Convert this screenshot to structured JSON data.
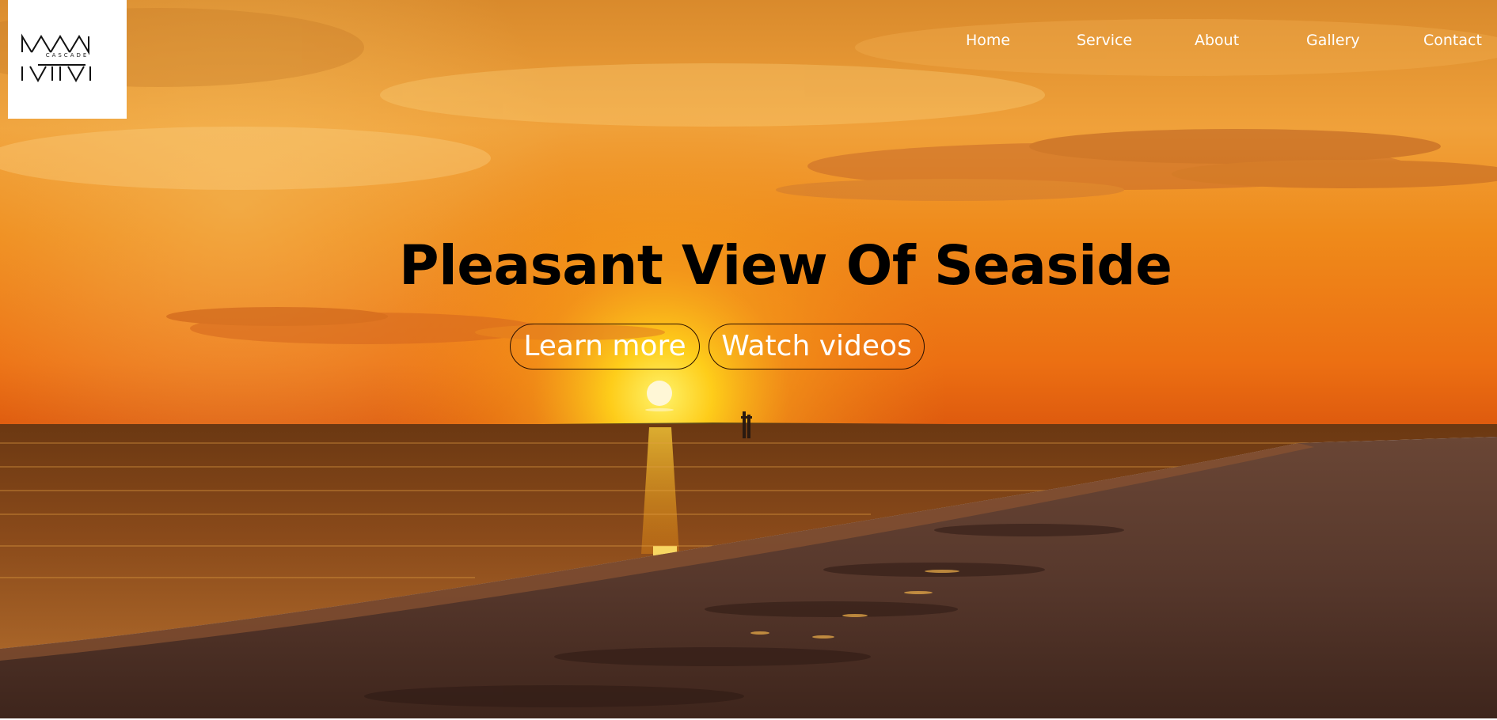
{
  "brand": {
    "logo_text": "CASCADE"
  },
  "nav": {
    "items": [
      {
        "label": "Home"
      },
      {
        "label": "Service"
      },
      {
        "label": "About"
      },
      {
        "label": "Gallery"
      },
      {
        "label": "Contact"
      }
    ]
  },
  "hero": {
    "title": "Pleasant View Of Seaside",
    "buttons": {
      "learn_more": "Learn more",
      "watch_videos": "Watch videos"
    }
  },
  "colors": {
    "title": "#000000",
    "nav_text": "#ffffff",
    "button_text": "#ffffff",
    "sky_top": "#e8962e",
    "sky_horizon": "#f07a10",
    "sun": "#fff6c8",
    "sea": "#5a3315",
    "sand": "#4a2e22"
  }
}
